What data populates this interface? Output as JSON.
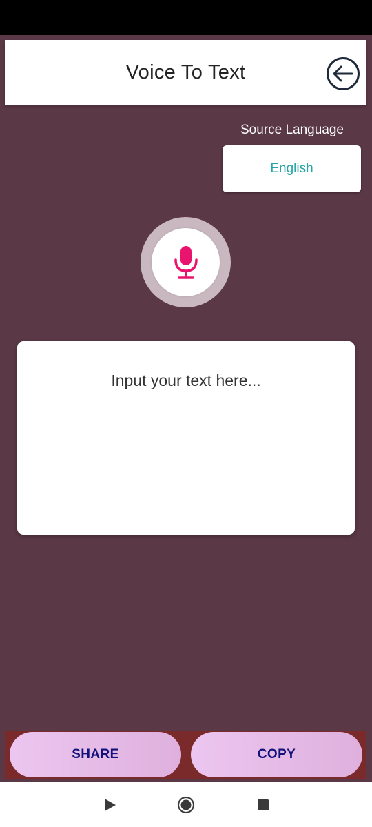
{
  "header": {
    "title": "Voice To Text",
    "back_icon": "arrow-left-circle-icon"
  },
  "language": {
    "source_label": "Source Language",
    "selected": "English",
    "accent_color": "#26a6a6"
  },
  "mic": {
    "icon": "microphone-icon",
    "color": "#e8146e"
  },
  "input": {
    "placeholder": "Input your text here..."
  },
  "actions": {
    "share_label": "SHARE",
    "copy_label": "COPY"
  },
  "navigation": {
    "back_icon": "triangle-back-icon",
    "home_icon": "circle-home-icon",
    "recents_icon": "square-recents-icon"
  },
  "colors": {
    "background": "#5a3845",
    "button_text": "#12127a"
  }
}
